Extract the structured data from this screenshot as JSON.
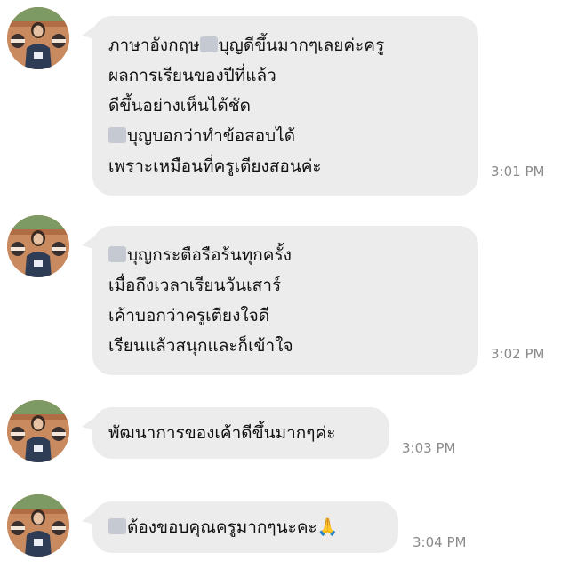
{
  "messages": [
    {
      "lines": [
        {
          "redacted": false,
          "text": "ภาษาอังกฤษ"
        },
        {
          "redacted": true,
          "text": "บุญดีขึ้นมากๆเลยค่ะครู"
        },
        {
          "redacted": false,
          "text": "ผลการเรียนของปีที่แล้ว"
        },
        {
          "redacted": false,
          "text": "ดีขึ้นอย่างเห็นได้ชัด"
        },
        {
          "redacted": true,
          "text": "บุญบอกว่าทำข้อสอบได้"
        },
        {
          "redacted": false,
          "text": "เพราะเหมือนที่ครูเตียงสอนค่ะ"
        }
      ],
      "time": "3:01 PM"
    },
    {
      "lines": [
        {
          "redacted": true,
          "text": "บุญกระตือรือร้นทุกครั้ง"
        },
        {
          "redacted": false,
          "text": "เมื่อถึงเวลาเรียนวันเสาร์"
        },
        {
          "redacted": false,
          "text": "เค้าบอกว่าครูเตียงใจดี"
        },
        {
          "redacted": false,
          "text": "เรียนแล้วสนุกและก็เข้าใจ"
        }
      ],
      "time": "3:02 PM"
    },
    {
      "lines": [
        {
          "redacted": false,
          "text": "พัฒนาการของเค้าดีขึ้นมากๆค่ะ"
        }
      ],
      "time": "3:03 PM"
    },
    {
      "lines": [
        {
          "redacted": true,
          "text": "ต้องขอบคุณครูมากๆนะคะ🙏"
        }
      ],
      "time": "3:04 PM"
    }
  ],
  "colors": {
    "bubble": "#ececec",
    "timestamp": "#8a8a8a",
    "redaction": "#c4c9d2"
  }
}
